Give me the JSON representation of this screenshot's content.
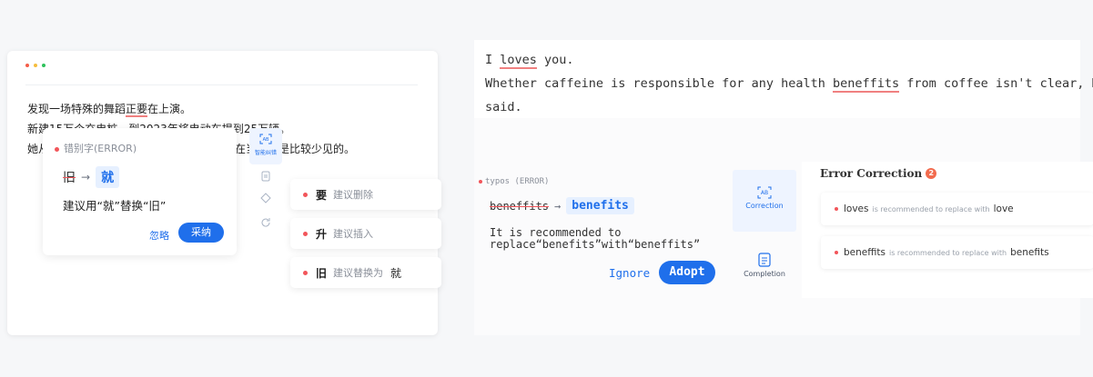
{
  "left": {
    "lines": [
      {
        "a": "发现一场特殊的舞蹈",
        "ul": "正要",
        "b": "在上演。"
      },
      {
        "a": "新建15万个充电桩、到2023年将电动车",
        "ul": "提",
        "b": "到25万辆。"
      },
      {
        "a": "她从小",
        "hl": "旧",
        "b": "很聪明，父亲还专门送她上学，这在当时也是比较少见的。"
      }
    ],
    "error_card": {
      "heading": "错别字(ERROR)",
      "wrong": "旧",
      "arrow": "→",
      "right": "就",
      "description": "建议用“就”替换“旧”",
      "ignore": "忽略",
      "adopt": "采纳"
    },
    "tools": {
      "smart": "智能纠错"
    },
    "suggestions": [
      {
        "word": "要",
        "text": "建议删除",
        "extra": ""
      },
      {
        "word": "升",
        "text": "建议插入",
        "extra": ""
      },
      {
        "word": "旧",
        "text": "建议替换为",
        "extra": "就"
      }
    ]
  },
  "right": {
    "text": {
      "line1_pre": "I ",
      "line1_ul": "loves",
      "line1_post": " you.",
      "line2_pre": "Whether caffeine is responsible for any health ",
      "line2_ul": "beneffits",
      "line2_post": " from coffee isn't clear, Kao",
      "line3": "said."
    },
    "card": {
      "heading": "typos (ERROR)",
      "wrong": "beneffits",
      "arrow": "→",
      "right": "benefits",
      "description": "It is recommended to replace“benefits”with“beneffits”",
      "ignore": "Ignore",
      "adopt": "Adopt"
    },
    "tools": {
      "correction": "Correction",
      "completion": "Completion"
    },
    "panel": {
      "title": "Error Correction",
      "count": "2",
      "items": [
        {
          "word": "loves",
          "mid": "is recommended to replace with",
          "replacement": "love"
        },
        {
          "word": "beneffits",
          "mid": "is recommended to replace with",
          "replacement": "benefits"
        }
      ]
    }
  },
  "colors": {
    "accent": "#1f6feb",
    "error": "#f2555a",
    "badge": "#f26b4e"
  }
}
